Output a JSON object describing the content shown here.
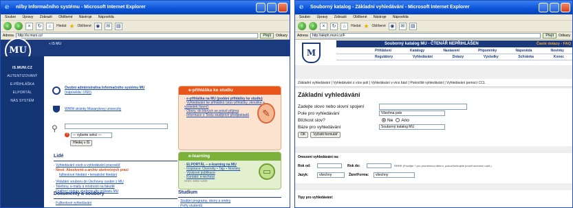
{
  "left_window": {
    "title": "ní/by Informačního systému - Microsoft Internet Explorer",
    "menu": [
      "Soubor",
      "Úpravy",
      "Zobrazit",
      "Oblíbené",
      "Nástroje",
      "Nápověda"
    ],
    "toolbar": {
      "search_label": "Hledat",
      "favorites_label": "Oblíbené"
    },
    "address": {
      "label": "Adresa",
      "value": "http://is.muni.cz/",
      "go_label": "Přejít",
      "links_label": "Odkazy"
    },
    "breadcrumb": "« IS MU",
    "sidebar": [
      "IS.MUNI.CZ",
      "AUTENTIZOVANÝ",
      "E-PŘIHLÁŠKA",
      "ELPORTÁL",
      "NÁS SYSTÉM"
    ],
    "main": {
      "is_link": "Osobní administrativa Informačního systému MU",
      "is_link_sub": "(nápověda: (/ISI))",
      "www_link": "WWW stránky Masarykovy univerzity",
      "search_select": "— vyberte sekci —",
      "search_button": "Hledej v IS",
      "lide_title": "Lidé",
      "lide_items": [
        "Vyhledávání osob a vyhledávání pracovišť",
        "Nové: Absolventi a archiv závěrečných prací",
        "Vkládání souboru do Úschovny osobní z MU",
        "Telefony, e-maily a místnosti na fakultě",
        "Ověření statutu studenta dle průkazu MU"
      ],
      "lide_subitem": "fulltextové hledání • tematické hledání",
      "dokumenty_title": "Dokumenty a soubory",
      "dokumenty_item": "Fulltextové vyhledávání"
    },
    "eprihlaska": {
      "title": "e-přihláška ke studiu",
      "items": [
        "e-přihláška na MU (podání přihlášky ke studiu)",
        "Vyhledávání ke přihlášků (stav přihlášky, zkouška a výsledek řízení)",
        "Obory, do kterých se právě přijímá",
        "Informace o Testu studijních předpokladů"
      ]
    },
    "elearning": {
      "title": "e-learning",
      "items": [
        "ELPORTÁL – e-learning na MU",
        "Inspirace: Osnovky • Tajy • Novinky",
        "Výukové publikace",
        "Kontakt: e-technici"
      ],
      "issn": "ISSN 1802-128X"
    },
    "studium": {
      "title": "Studium",
      "items": [
        "Studijní programy, obory a směry",
        "Pořty studentů"
      ]
    }
  },
  "right_window": {
    "title": "Souborný katalog - Základní vyhledávání - Microsoft Internet Explorer",
    "menu": [
      "Soubor",
      "Úpravy",
      "Zobrazit",
      "Oblíbené",
      "Nástroje",
      "Nápověda"
    ],
    "toolbar": {
      "search_label": "Hledat",
      "favorites_label": "Oblíbené"
    },
    "address": {
      "label": "Adresa",
      "value": "http://aleph.muni.cz/F",
      "go_label": "Přejít",
      "links_label": "Odkazy"
    },
    "banner": "Souborný katalog MU - ČTENÁŘ NEPŘIHLÁŠEN",
    "help_link": "Časté dotazy - FAQ",
    "nav_row1": [
      "Přihlášení",
      "Katalogy",
      "Nastavení",
      "Připomínky",
      "Nápověda",
      "Novinky"
    ],
    "nav_row2": [
      "Regulátory",
      "Vyhledávání",
      "Dotazy",
      "Výsledky",
      "Schránka",
      "Konec"
    ],
    "search_links": "Základní vyhledávání | Vyhledávání z více polí | Vyhledávání v více bází | Pokročilé vyhledávání | Vyhledávání pomocí CCL",
    "form": {
      "heading": "Základní vyhledávání",
      "query_label": "Zadejte slovo nebo slovní spojení",
      "query_value": "",
      "field_label": "Pole pro vyhledávání",
      "field_value": "Všechna pole",
      "proximity_label": "Blízkost slov?",
      "radio_no": "Ne",
      "radio_yes": "Ano",
      "base_label": "Báze pro vyhledávání",
      "base_value": "Souborný katalog MU",
      "ok_button": "OK",
      "clear_button": "Vyčistit formulář"
    },
    "limits": {
      "title": "Omezení vyhledávání na:",
      "year_from": "Rok od:",
      "year_to": "Rok do:",
      "year_hint": "RRRR (Použijte ? pro proměnnou dělení, pokud tečkujete použit omezení roků.)",
      "lang_label": "Jazyk:",
      "lang_value": "všechny",
      "format_label": "Žánr/Forma:",
      "format_value": "všechny"
    },
    "tips": "Tipy pro vyhledávání:"
  },
  "colors": {
    "mu_blue": "#1b3a7e",
    "xp_title": "#0a53d6",
    "orange": "#e8561c",
    "green": "#7cb23b"
  }
}
